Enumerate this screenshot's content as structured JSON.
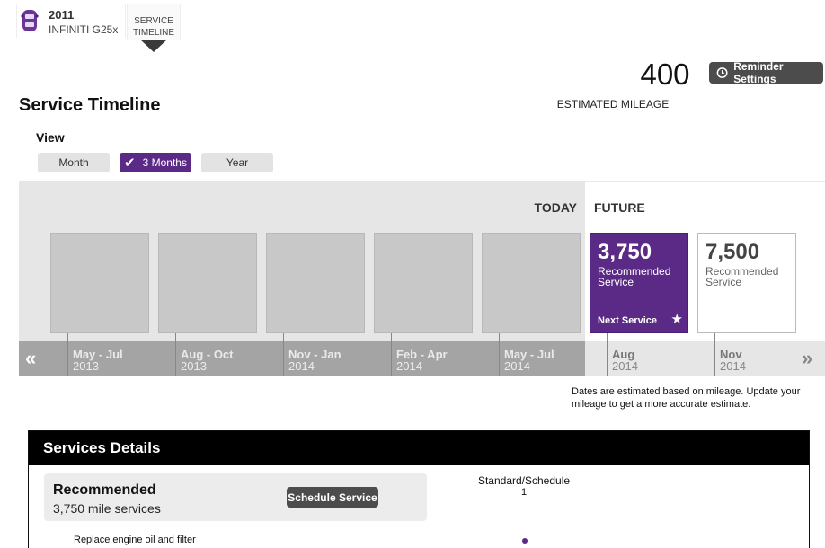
{
  "vehicle": {
    "year": "2011",
    "name": "INFINITI G25x"
  },
  "nav": {
    "service_tab_line1": "SERVICE",
    "service_tab_line2": "TIMELINE"
  },
  "mileage": {
    "value": "400",
    "label": "ESTIMATED MILEAGE"
  },
  "reminder_button": "Reminder Settings",
  "page_title": "Service Timeline",
  "view": {
    "label": "View",
    "options": [
      {
        "label": "Month",
        "active": false
      },
      {
        "label": "3 Months",
        "active": true
      },
      {
        "label": "Year",
        "active": false
      }
    ]
  },
  "timeline": {
    "today_label": "TODAY",
    "future_label": "FUTURE",
    "periods": [
      {
        "range": "May - Jul",
        "year": "2013"
      },
      {
        "range": "Aug - Oct",
        "year": "2013"
      },
      {
        "range": "Nov - Jan",
        "year": "2014"
      },
      {
        "range": "Feb - Apr",
        "year": "2014"
      },
      {
        "range": "May - Jul",
        "year": "2014"
      },
      {
        "range": "Aug",
        "year": "2014"
      },
      {
        "range": "Nov",
        "year": "2014"
      }
    ],
    "services": [
      {
        "miles": "3,750",
        "label": "Recommended Service",
        "badge": "Next Service"
      },
      {
        "miles": "7,500",
        "label": "Recommended Service"
      }
    ],
    "note": "Dates are estimated based on mileage. Update your mileage to get a more accurate estimate."
  },
  "details": {
    "title": "Services Details",
    "recommended_title": "Recommended",
    "recommended_sub": "3,750 mile services",
    "schedule_button": "Schedule Service",
    "standard_label": "Standard/Schedule",
    "standard_number": "1",
    "items": [
      "Replace engine oil and filter"
    ]
  },
  "colors": {
    "accent": "#5b2a86",
    "dark_button": "#4c4c4c"
  },
  "icons": {
    "vehicle": "car-icon",
    "reminder": "clock-icon",
    "check": "check-icon",
    "star": "star-icon"
  }
}
